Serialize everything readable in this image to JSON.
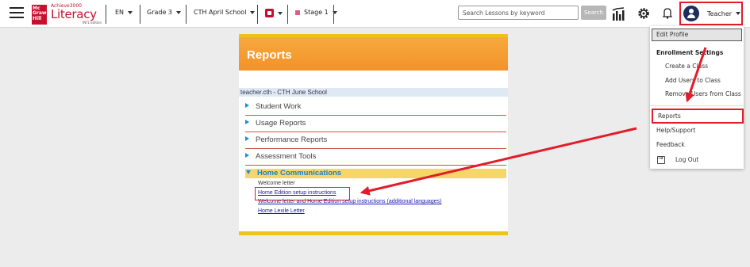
{
  "header": {
    "logo": {
      "brand": "Mc Graw Hill",
      "product_small": "Achieve3000",
      "product": "Literacy",
      "edition": "INTL Edition"
    },
    "language": "EN",
    "grade": "Grade 3",
    "school": "CTH April School",
    "stage": "Stage 1",
    "search": {
      "placeholder": "Search Lessons by keyword",
      "button": "Search"
    },
    "user": "Teacher"
  },
  "reports": {
    "title": "Reports",
    "school_line": "teacher.cth - CTH June School",
    "items": [
      "Student Work",
      "Usage Reports",
      "Performance Reports",
      "Assessment Tools"
    ],
    "home": {
      "title": "Home Communications",
      "links": [
        "Welcome letter",
        "Home Edition setup instructions",
        "Welcome letter and Home Edition setup instructions (additional languages)",
        "Home Lexile Letter"
      ]
    }
  },
  "menu": {
    "edit_profile": "Edit Profile",
    "enrollment": "Enrollment Settings",
    "enrollment_items": [
      "Create a Class",
      "Add Users to Class",
      "Remove Users from Class"
    ],
    "reports": "Reports",
    "help": "Help/Support",
    "feedback": "Feedback",
    "logout": "Log Out"
  },
  "colors": {
    "accent_red": "#e21c2a",
    "brand_red": "#c8102e",
    "report_orange": "#f2922b",
    "link_blue": "#1a1aa6"
  }
}
